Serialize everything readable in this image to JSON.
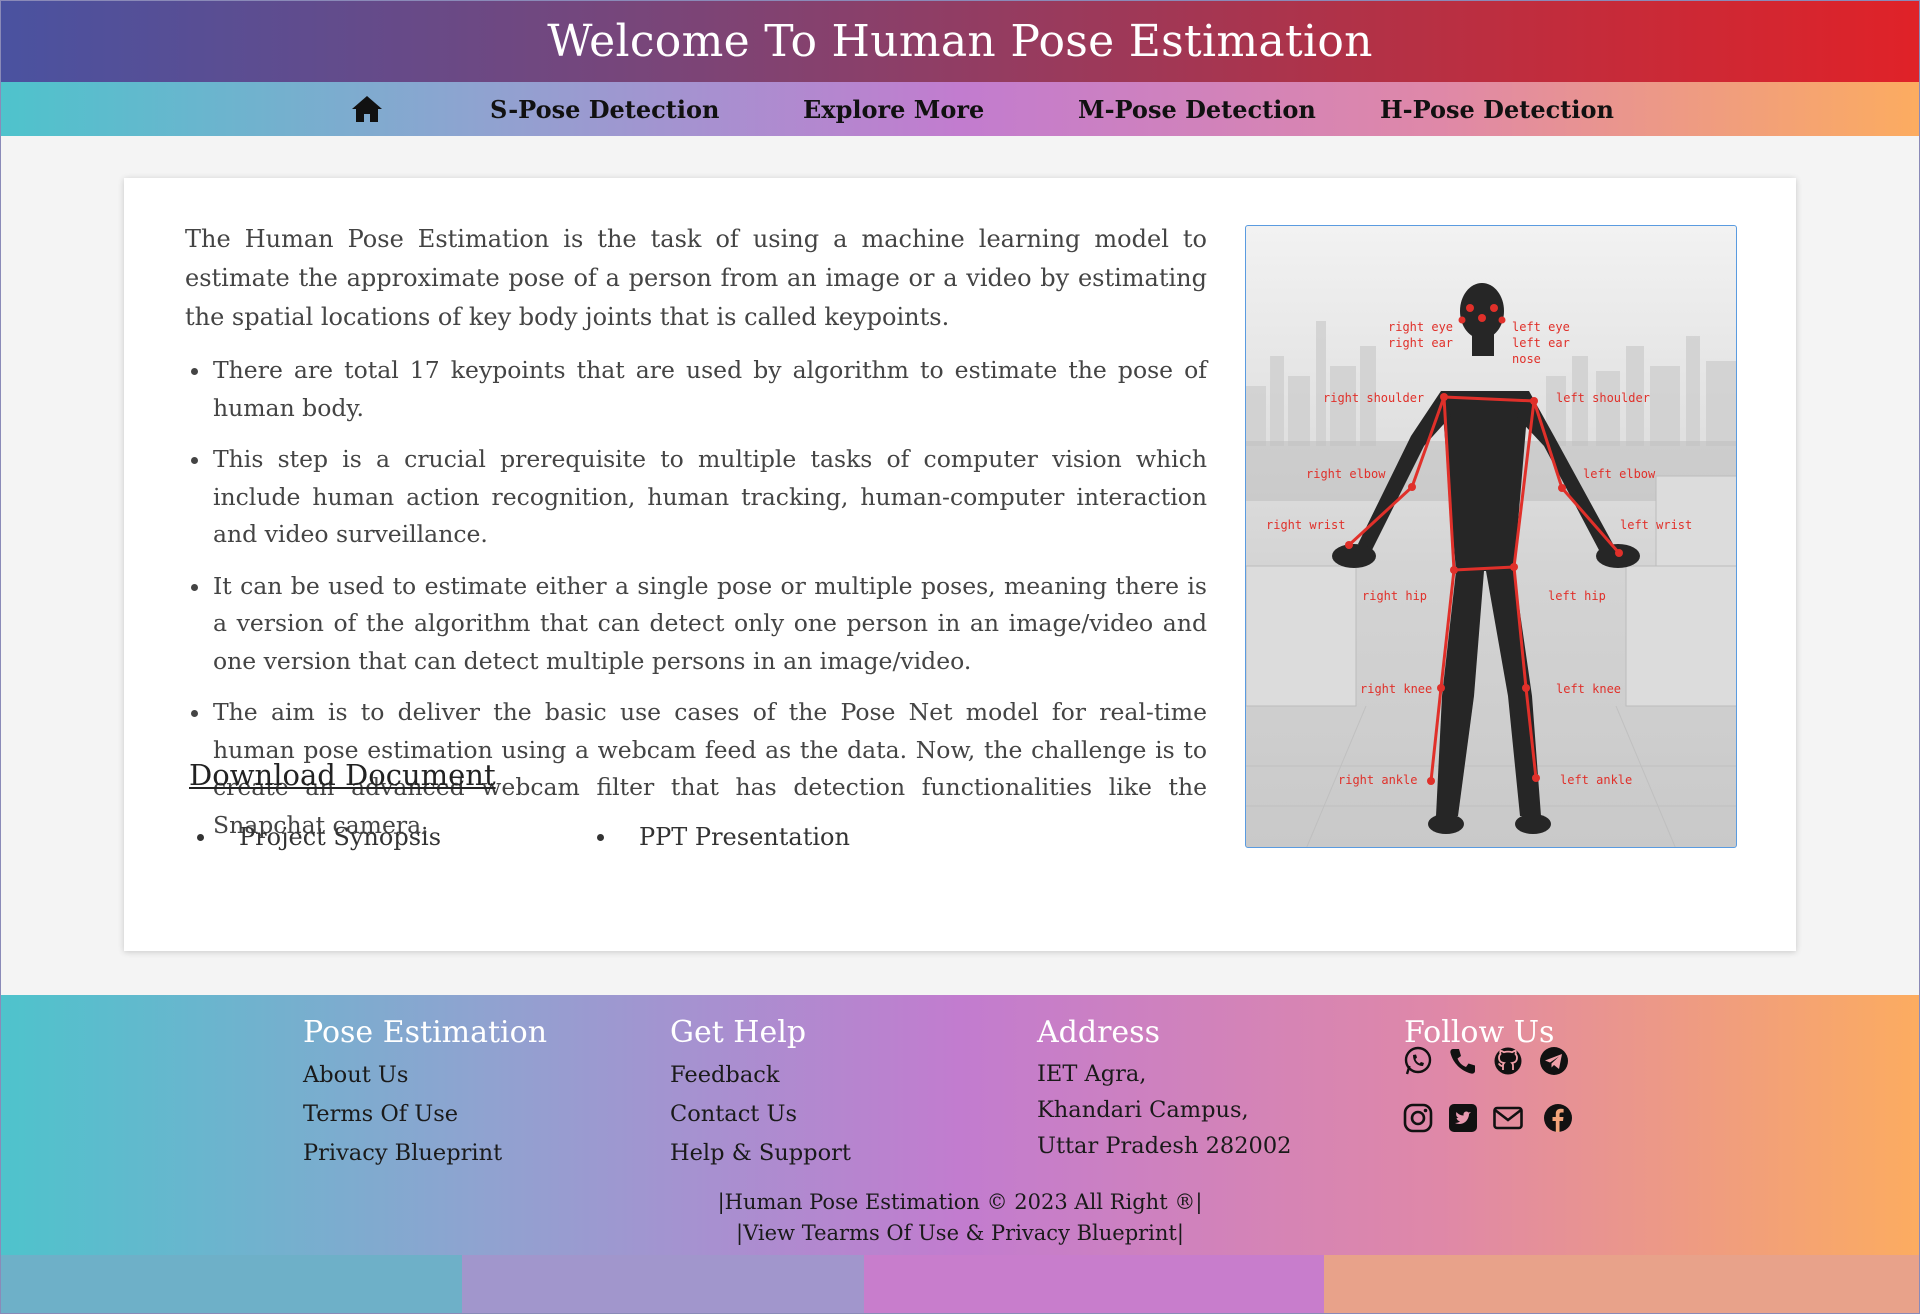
{
  "header": {
    "title": "Welcome To Human Pose Estimation"
  },
  "nav": {
    "home_icon": "home-icon",
    "items": [
      {
        "label": "S-Pose Detection"
      },
      {
        "label": "Explore More"
      },
      {
        "label": "M-Pose Detection"
      },
      {
        "label": "H-Pose Detection"
      }
    ]
  },
  "main": {
    "intro": "The Human Pose Estimation is the task of using a machine learning model to estimate the approximate pose of a person from an image or a video by estimating the spatial locations of key body joints that is called keypoints.",
    "bullets": [
      "There are total 17 keypoints that are used by algorithm to estimate the pose of human body.",
      "This step is a crucial prerequisite to multiple tasks of computer vision which include human action recognition, human tracking, human-computer interaction and video surveillance.",
      "It can be used to estimate either a single pose or multiple poses, meaning there is a version of the algorithm that can detect only one person in an image/video and one version that can detect multiple persons in an image/video.",
      "The aim is to deliver the basic use cases of the Pose Net model for real-time human pose estimation using a webcam feed as the data. Now, the challenge is to create an advanced webcam filter that has detection functionalities like the Snapchat camera."
    ],
    "download_title": "Download Document",
    "documents": [
      "Project Synopsis",
      "PPT Presentation"
    ],
    "figure_labels": {
      "right_eye": "right eye",
      "right_ear": "right ear",
      "left_eye": "left eye",
      "left_ear": "left ear",
      "nose": "nose",
      "right_shoulder": "right shoulder",
      "left_shoulder": "left shoulder",
      "right_elbow": "right elbow",
      "left_elbow": "left elbow",
      "right_wrist": "right wrist",
      "left_wrist": "left wrist",
      "right_hip": "right hip",
      "left_hip": "left hip",
      "right_knee": "right knee",
      "left_knee": "left knee",
      "right_ankle": "right ankle",
      "left_ankle": "left ankle"
    }
  },
  "footer": {
    "col1": {
      "heading": "Pose Estimation",
      "links": [
        "About Us",
        "Terms Of Use",
        "Privacy Blueprint"
      ]
    },
    "col2": {
      "heading": "Get Help",
      "links": [
        "Feedback",
        "Contact Us",
        "Help & Support"
      ]
    },
    "col3": {
      "heading": "Address",
      "lines": [
        "IET Agra,",
        "Khandari Campus,",
        "Uttar Pradesh 282002"
      ]
    },
    "col4": {
      "heading": "Follow Us",
      "icons": [
        "whatsapp-icon",
        "phone-icon",
        "github-icon",
        "telegram-icon",
        "instagram-icon",
        "twitter-icon",
        "mail-icon",
        "facebook-icon"
      ]
    },
    "copyright": "|Human Pose Estimation © 2023 All Right ®|",
    "terms_line": "|View Tearms Of Use & Privacy Blueprint|"
  },
  "colors": {
    "title_gradient": [
      "#4a52a0",
      "#e02228"
    ],
    "nav_gradient": [
      "#4ec3cc",
      "#c27ccf",
      "#fcac60"
    ],
    "keypoint": "#e0302a",
    "figure_border": "#5a9be0"
  }
}
